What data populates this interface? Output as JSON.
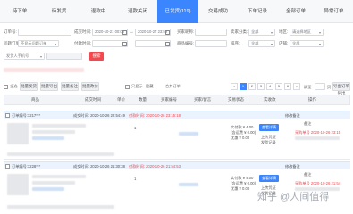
{
  "tabs": [
    {
      "label": "待下单"
    },
    {
      "label": "待发货"
    },
    {
      "label": "退款中"
    },
    {
      "label": "退款关闭"
    },
    {
      "label": "已发货(119)"
    },
    {
      "label": "交易成功"
    },
    {
      "label": "下单记录"
    },
    {
      "label": "全部订单"
    },
    {
      "label": "异常订单"
    }
  ],
  "filters": {
    "order_id_label": "订单号:",
    "time_label": "成交时间:",
    "time_from": "2020-10-21 00:00",
    "time_sep": "→",
    "time_to": "2020-10-27 23:59",
    "buyer_label": "买家昵称:",
    "seller_label": "卖家分类:",
    "seller_value": "全部",
    "region_label": "地区:",
    "region_value": "请选择地区",
    "flag_label": "问题订单:",
    "flag_value": "不显示问题订单",
    "pay_label": "付款时间:",
    "goods_label": "商品编号:",
    "sort_label": "排序:",
    "sort_value": "全部",
    "source_label": "店铺:",
    "source_value": "全部",
    "extra_value": "发货人手机号",
    "search_label": "搜索",
    "clear_label": "清空"
  },
  "toolbar": {
    "select_all": "全选",
    "batch_buttons": [
      "批量发货",
      "批量导出",
      "批量备注",
      "批量改价"
    ],
    "filter_check": "只显示",
    "filter_link": "隐藏",
    "merge_label": "合并订单",
    "download_label": "导出订单导出",
    "page_prev": "<",
    "page_current": "1",
    "pages": [
      "2",
      "3",
      "4",
      "5",
      "6"
    ],
    "page_next": ">",
    "page_jump": "跳至",
    "page_unit": "页"
  },
  "table_headers": [
    "商品",
    "成交时间",
    "单价",
    "数量",
    "买家编号",
    "买家/留言",
    "交易状态",
    "实收款",
    "操作"
  ],
  "orders": [
    {
      "order_no": "订单编号:1217***",
      "deal_time": "成交时间: 2020-10-26 22:54:49",
      "pay_time": "付款时间: 2020-10-26 23:15:18",
      "qty": "1",
      "status1": "修改备注",
      "status2": "已发货",
      "amount": "4.00",
      "price_lines": [
        "实付款 ¥ 4.00",
        "(含运费 ¥ 0.00)",
        "优惠 ¥ 0.00"
      ],
      "detail_label": "查看详情",
      "ops": [
        "上传凭证",
        "发货记录"
      ],
      "note": "备注",
      "receiver": "收件人",
      "receiver_detail": "采购单号 2020-10-26 23:15"
    },
    {
      "order_no": "订单编号:1228***",
      "deal_time": "成交时间: 2020-10-26 21:30:38",
      "pay_time": "付款时间: 2020-10-26 21:54:53",
      "qty": "1",
      "status1": "修改备注",
      "status2": "已发货",
      "amount": "4.00",
      "price_lines": [
        "实付款 ¥ 4.00",
        "(含运费 ¥ 0.00)",
        "优惠 ¥ 0.00"
      ],
      "detail_label": "查看详情",
      "ops": [
        "上传凭证",
        "发货记录"
      ],
      "note": "备注",
      "receiver": "收件人",
      "receiver_detail": "采购单号 2020-10-26 21:54"
    }
  ],
  "row_links": [
    "发货",
    "改价",
    "备注"
  ],
  "footer_text": "2020-10-26 21:54",
  "watermark": "知乎 @人间值得"
}
